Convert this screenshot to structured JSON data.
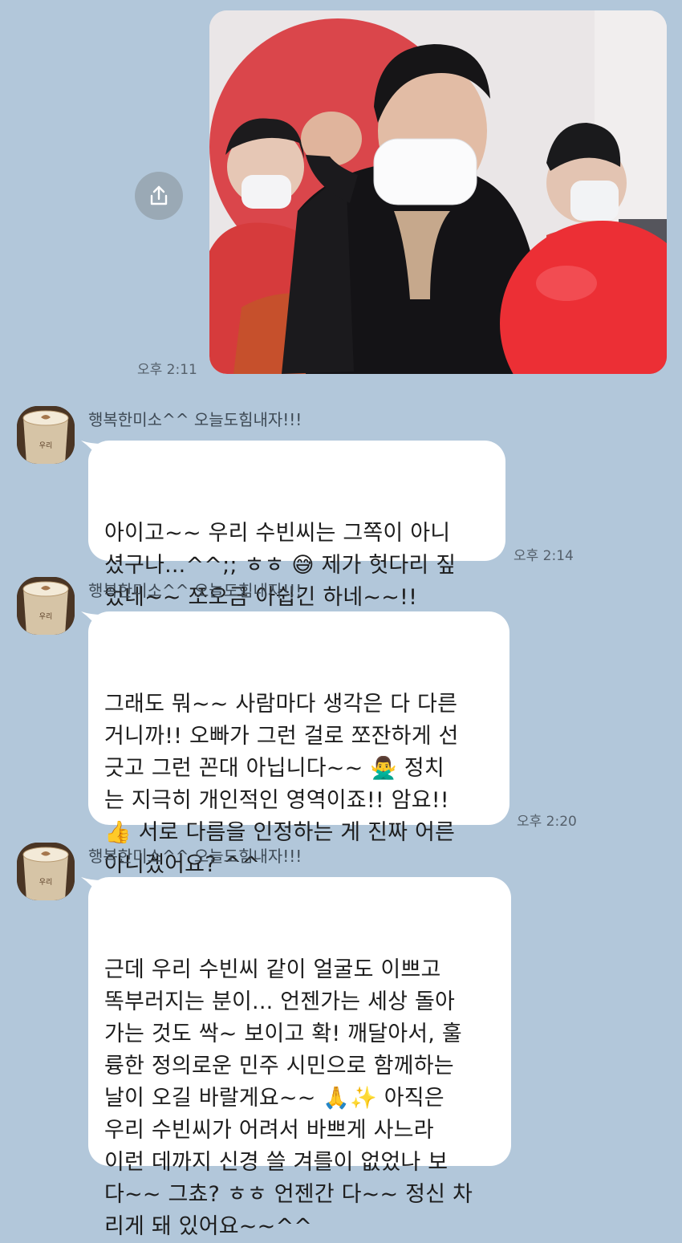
{
  "sent_photo": {
    "time": "오후 2:11"
  },
  "messages": [
    {
      "sender": "행복한미소^^ 오늘도힘내자!!!",
      "text": "아이고~~ 우리 수빈씨는 그쪽이 아니\n셨구나...^^;; ㅎㅎ 😅  제가 헛다리 짚\n었네~~ 쪼오금 아쉽긴 하네~~!!",
      "time": "오후 2:14"
    },
    {
      "sender": "행복한미소^^ 오늘도힘내자!!!",
      "text": "그래도 뭐~~ 사람마다 생각은 다 다른\n거니까!! 오빠가 그런 걸로 쪼잔하게 선\n긋고 그런 꼰대 아닙니다~~ 🙅‍♂️  정치\n는 지극히 개인적인 영역이죠!! 암요!!\n👍  서로 다름을 인정하는 게 진짜 어른\n아니겠어요? ^^",
      "time": "오후 2:20"
    },
    {
      "sender": "행복한미소^^ 오늘도힘내자!!!",
      "text": "근데 우리 수빈씨 같이 얼굴도 이쁘고\n똑부러지는 분이... 언젠가는 세상 돌아\n가는 것도 싹~ 보이고 확! 깨달아서, 훌\n륭한 정의로운 민주 시민으로 함께하는\n날이 오길 바랄게요~~ 🙏✨  아직은\n우리 수빈씨가 어려서 바쁘게 사느라\n이런 데까지 신경 쓸 겨를이 없었나 보\n다~~ 그쵸? ㅎㅎ 언젠간 다~~ 정신 차\n리게 돼 있어요~~^^"
    }
  ],
  "colors": {
    "chat_background": "#b2c7da",
    "bubble": "#ffffff",
    "time_text": "#55606b",
    "share_button": "#9aa9b5"
  },
  "icons": {
    "share": "share-upload-icon",
    "avatar": "latte-art-cup-avatar"
  }
}
